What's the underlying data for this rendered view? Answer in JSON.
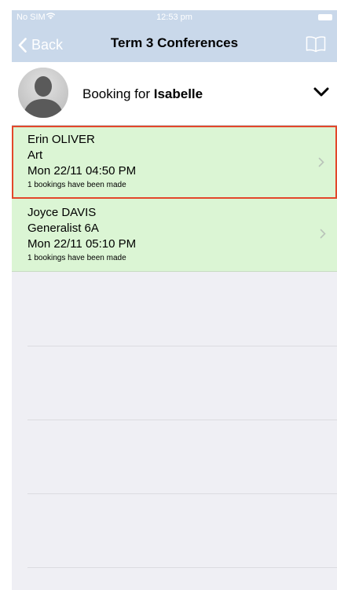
{
  "status": {
    "carrier": "No SIM",
    "time": "12:53 pm"
  },
  "nav": {
    "back_label": "Back",
    "title": "Term 3 Conferences"
  },
  "booking": {
    "prefix": "Booking for",
    "student": "Isabelle"
  },
  "bookings": [
    {
      "teacher": "Erin OLIVER",
      "subject": "Art",
      "when": "Mon 22/11 04:50 PM",
      "note": "1 bookings have been made"
    },
    {
      "teacher": "Joyce DAVIS",
      "subject": "Generalist 6A",
      "when": "Mon 22/11 05:10 PM",
      "note": "1 bookings have been made"
    }
  ],
  "colors": {
    "nav_bg": "#c9d8ea",
    "row_bg": "#dbf5d4",
    "selection_border": "#e3472a"
  }
}
